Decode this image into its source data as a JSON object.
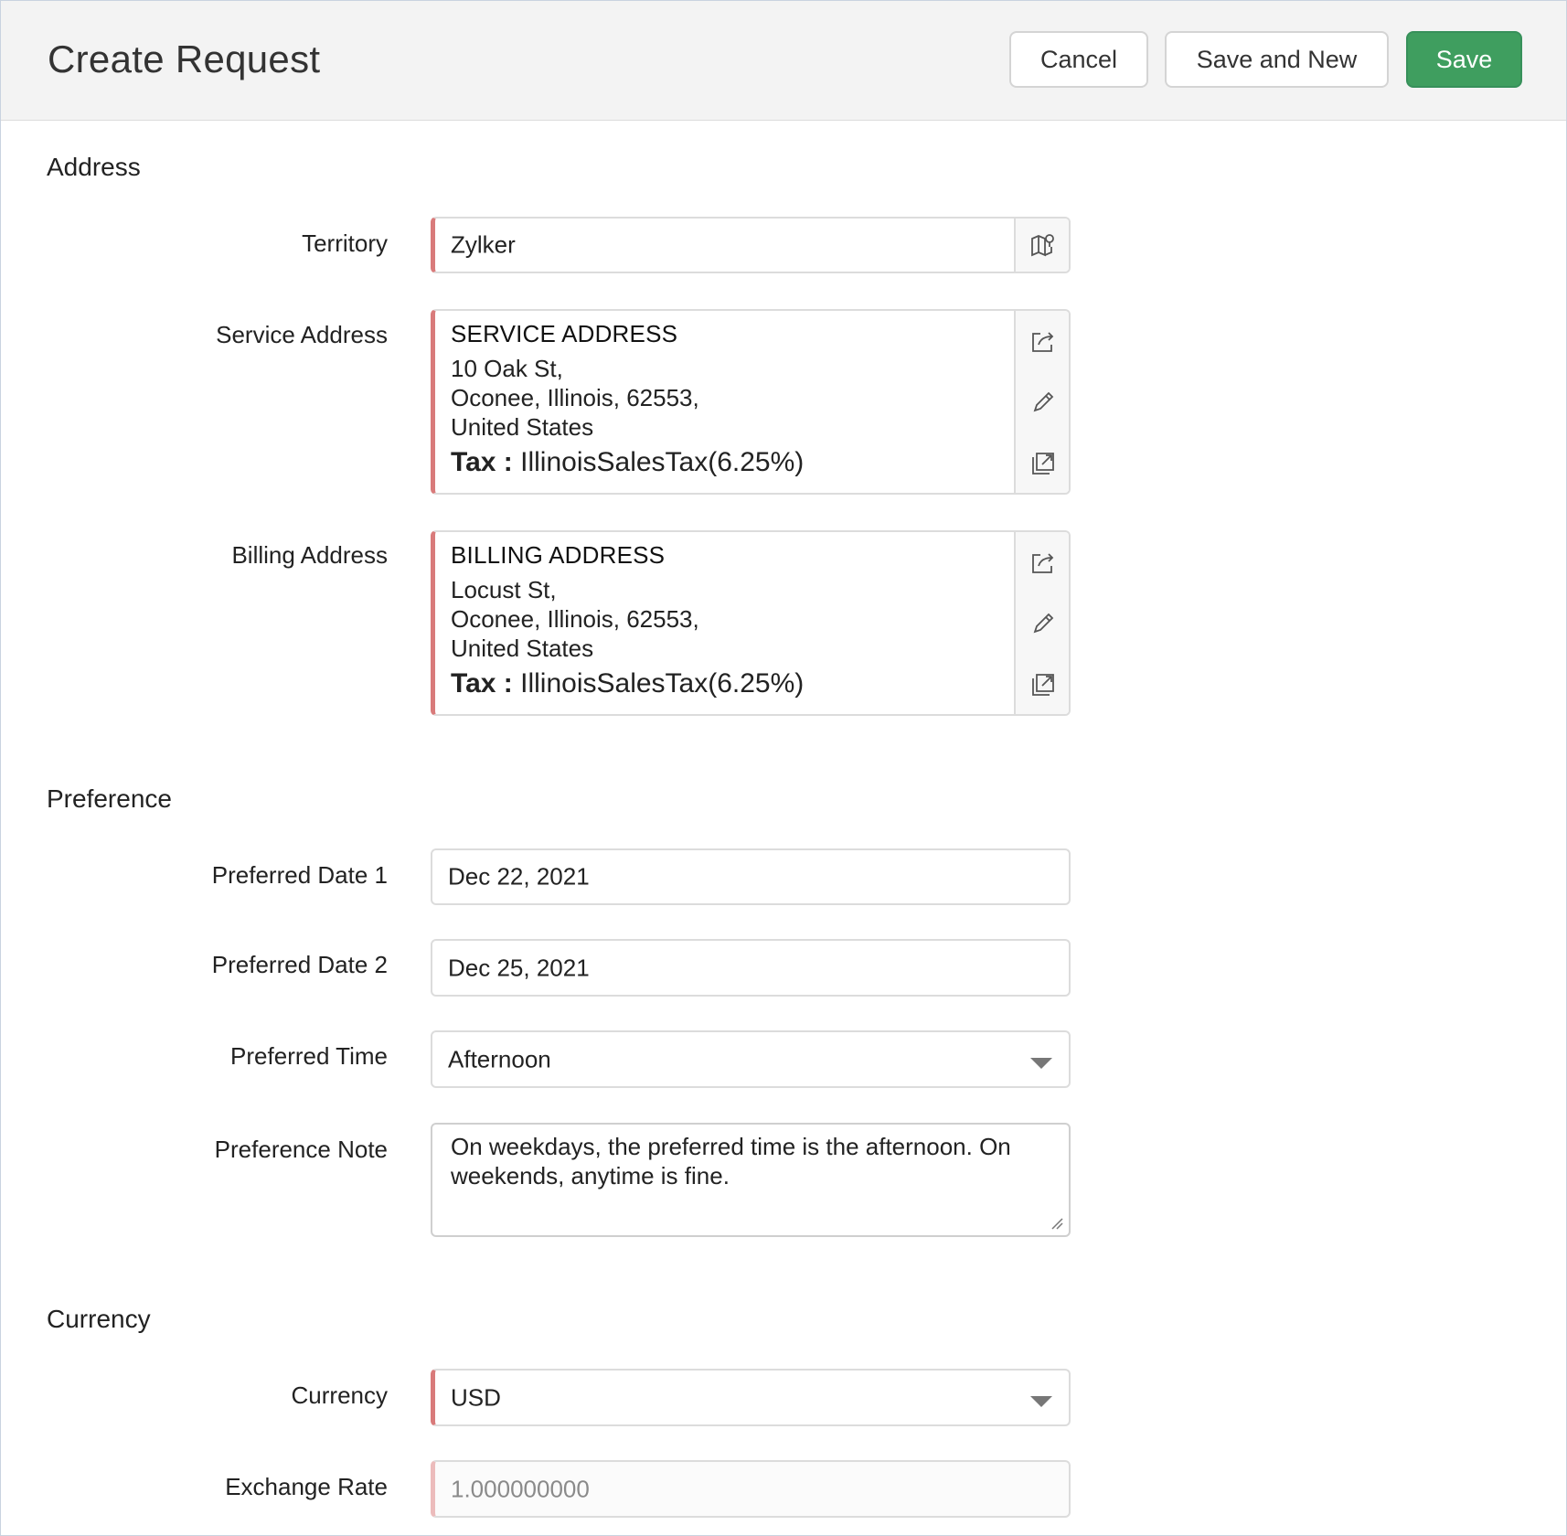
{
  "header": {
    "title": "Create Request",
    "cancel_label": "Cancel",
    "save_new_label": "Save and New",
    "save_label": "Save"
  },
  "sections": {
    "address": "Address",
    "preference": "Preference",
    "currency": "Currency"
  },
  "address": {
    "territory": {
      "label": "Territory",
      "value": "Zylker",
      "icon": "map-pin-icon"
    },
    "service": {
      "label": "Service Address",
      "heading": "SERVICE ADDRESS",
      "line1": "10 Oak St,",
      "line2": "Oconee, Illinois, 62553,",
      "line3": "United States",
      "tax_label": "Tax :",
      "tax_value": " IllinoisSalesTax(6.25%)"
    },
    "billing": {
      "label": "Billing Address",
      "heading": "BILLING ADDRESS",
      "line1": "Locust St,",
      "line2": "Oconee, Illinois, 62553,",
      "line3": "United States",
      "tax_label": "Tax :",
      "tax_value": " IllinoisSalesTax(6.25%)"
    }
  },
  "preference": {
    "date1": {
      "label": "Preferred Date 1",
      "value": "Dec 22, 2021"
    },
    "date2": {
      "label": "Preferred Date 2",
      "value": "Dec 25, 2021"
    },
    "time": {
      "label": "Preferred Time",
      "value": "Afternoon"
    },
    "note": {
      "label": "Preference Note",
      "value": "On weekdays, the preferred time is the afternoon. On weekends, anytime is fine."
    }
  },
  "currency": {
    "currency": {
      "label": "Currency",
      "value": "USD"
    },
    "exchange_rate": {
      "label": "Exchange Rate",
      "value": "1.000000000"
    }
  },
  "colors": {
    "primary_button": "#3f9e5f",
    "mandatory_marker": "#d97b7b",
    "header_bg": "#f3f3f3"
  }
}
